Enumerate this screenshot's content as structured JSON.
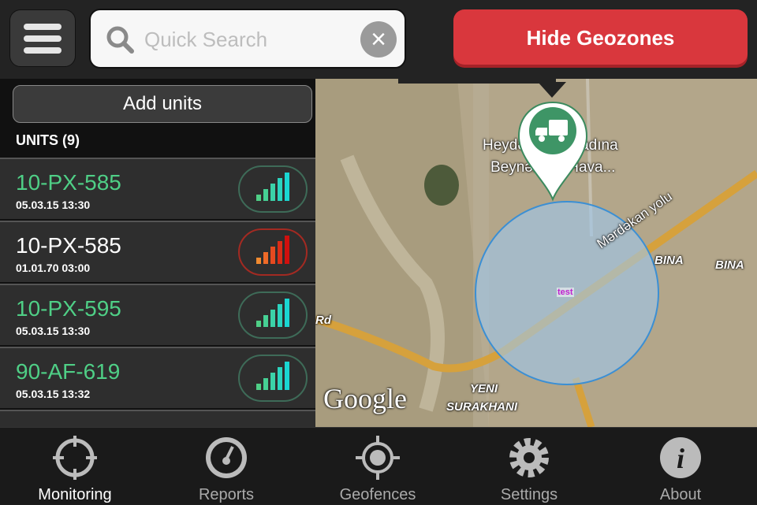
{
  "header": {
    "search_placeholder": "Quick Search",
    "hide_geozones_label": "Hide Geozones",
    "icons": [
      "menu-icon",
      "search-icon",
      "clear-icon"
    ]
  },
  "units_panel": {
    "add_units_label": "Add units",
    "units_title": "UNITS (9)",
    "units": [
      {
        "name": "10-PX-585",
        "time": "05.03.15 13:30",
        "status": "online",
        "color": "#4fcf86"
      },
      {
        "name": "10-PX-585",
        "time": "01.01.70 03:00",
        "status": "offline",
        "color": "#ffffff"
      },
      {
        "name": "10-PX-595",
        "time": "05.03.15 13:30",
        "status": "online",
        "color": "#4fcf86"
      },
      {
        "name": "90-AF-619",
        "time": "05.03.15 13:32",
        "status": "online",
        "color": "#4fcf86"
      }
    ]
  },
  "map": {
    "labels": {
      "airport1": "Heydər Əliyev adına",
      "airport2": "Beynəlxalq Hava...",
      "road": "Mərdəkan yolu",
      "bina1": "BINA",
      "bina2": "BINA",
      "rd": "Rd",
      "yeni": "YENI",
      "surakhani": "SURAKHANI",
      "geozone": "test",
      "google": "Google"
    },
    "pin_icon": "truck-icon",
    "geozone_color": "#9cc8ef"
  },
  "tabbar": {
    "items": [
      {
        "label": "Monitoring",
        "icon": "crosshair-icon",
        "active": true
      },
      {
        "label": "Reports",
        "icon": "speedometer-icon",
        "active": false
      },
      {
        "label": "Geofences",
        "icon": "geofence-target-icon",
        "active": false
      },
      {
        "label": "Settings",
        "icon": "gear-icon",
        "active": false
      },
      {
        "label": "About",
        "icon": "info-icon",
        "active": false
      }
    ]
  }
}
